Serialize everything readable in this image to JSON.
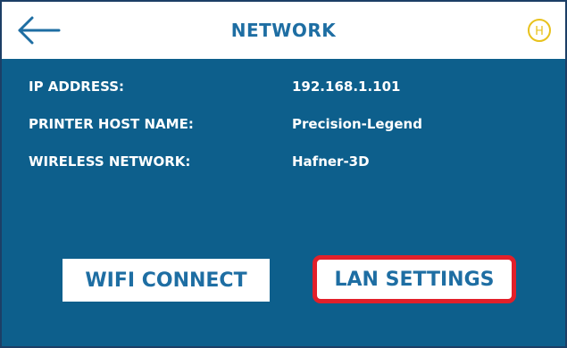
{
  "header": {
    "title": "NETWORK",
    "home_glyph": "H"
  },
  "info": {
    "ip_label": "IP ADDRESS:",
    "ip_value": "192.168.1.101",
    "host_label": "PRINTER HOST NAME:",
    "host_value": "Precision-Legend",
    "wireless_label": "WIRELESS NETWORK:",
    "wireless_value": "Hafner-3D"
  },
  "buttons": {
    "wifi_connect": "WIFI CONNECT",
    "lan_settings": "LAN SETTINGS"
  },
  "colors": {
    "background": "#0d5f8c",
    "header_bg": "#ffffff",
    "accent_text": "#1e6ea3",
    "home_icon": "#e8c21c",
    "highlight": "#e2202a"
  },
  "icons": {
    "back": "left-arrow-icon",
    "home": "home-h-icon"
  }
}
